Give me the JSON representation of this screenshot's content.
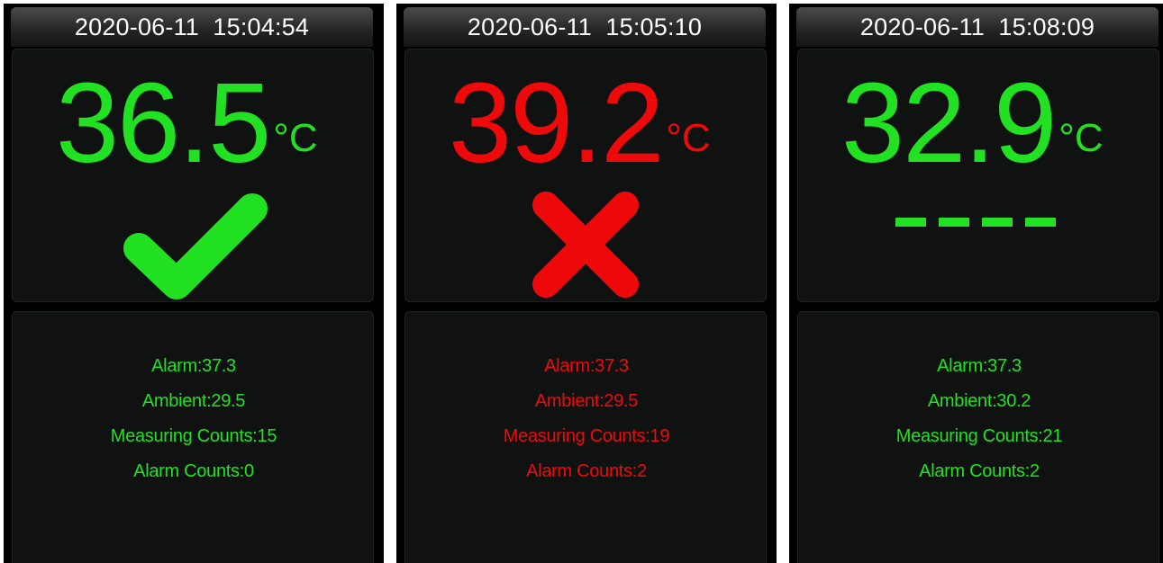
{
  "screens": [
    {
      "datetime": "2020-06-11  15:04:54",
      "temperature": "36.5",
      "unit": "°C",
      "status": "normal",
      "status_icon": "check-icon",
      "color": "#22e022",
      "alarm": "Alarm:37.3",
      "ambient": "Ambient:29.5",
      "measuring_counts": "Measuring Counts:15",
      "alarm_counts": "Alarm Counts:0"
    },
    {
      "datetime": "2020-06-11  15:05:10",
      "temperature": "39.2",
      "unit": "°C",
      "status": "alarm",
      "status_icon": "cross-icon",
      "color": "#ee0a0a",
      "alarm": "Alarm:37.3",
      "ambient": "Ambient:29.5",
      "measuring_counts": "Measuring Counts:19",
      "alarm_counts": "Alarm Counts:2"
    },
    {
      "datetime": "2020-06-11  15:08:09",
      "temperature": "32.9",
      "unit": "°C",
      "status": "invalid",
      "status_icon": "dashes-icon",
      "color": "#22e022",
      "alarm": "Alarm:37.3",
      "ambient": "Ambient:30.2",
      "measuring_counts": "Measuring Counts:21",
      "alarm_counts": "Alarm Counts:2"
    }
  ]
}
